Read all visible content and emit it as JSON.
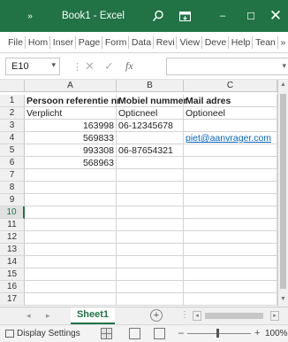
{
  "titlebar": {
    "quick_access": "»",
    "title": "Book1 - Excel",
    "search_icon": "search-icon",
    "ribbon_icon": "ribbon-display-icon",
    "minimize": "–",
    "maximize": "☐",
    "close": "✕"
  },
  "ribbon": {
    "tabs": [
      "File",
      "Hom",
      "Inser",
      "Page",
      "Form",
      "Data",
      "Revi",
      "View",
      "Deve",
      "Help",
      "Tean",
      "»"
    ]
  },
  "formula_bar": {
    "name_box": "E10",
    "name_box_arrow": "▾",
    "separator": "⋮",
    "cancel": "✕",
    "enter": "✓",
    "fx": "fx",
    "formula": "",
    "expand": "▾"
  },
  "sheet": {
    "columns": [
      "A",
      "B",
      "C"
    ],
    "rows": [
      "1",
      "2",
      "3",
      "4",
      "5",
      "6",
      "7",
      "8",
      "9",
      "10",
      "11",
      "12",
      "13",
      "14",
      "15",
      "16",
      "17"
    ],
    "active_row": "10",
    "cells": {
      "r1": [
        "Persoon referentie nr",
        "Mobiel nummer",
        "Mail adres"
      ],
      "r2": [
        "Verplicht",
        "Opticneel",
        "Optioneel"
      ],
      "r3": [
        "163998",
        "06-12345678",
        ""
      ],
      "r4": [
        "569833",
        "",
        "piet@aanvrager.com"
      ],
      "r5": [
        "993308",
        "06-87654321",
        ""
      ],
      "r6": [
        "568963",
        "",
        ""
      ]
    }
  },
  "sheet_tabs": {
    "prev": "◂",
    "next": "▸",
    "active": "Sheet1",
    "add": "+",
    "dots": "⋮",
    "scroll_left": "◂",
    "scroll_right": "▸"
  },
  "statusbar": {
    "display_settings": "Display Settings",
    "zoom_minus": "–",
    "zoom_plus": "+",
    "zoom": "100%"
  },
  "colors": {
    "excel_green": "#217346",
    "hyperlink": "#0563c1"
  }
}
